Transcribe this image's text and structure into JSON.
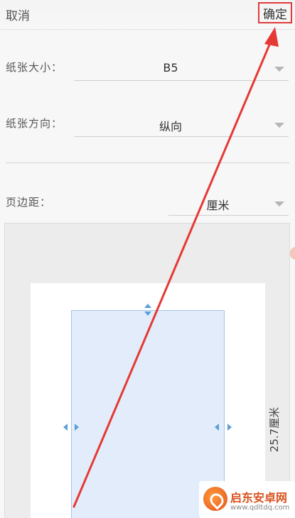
{
  "header": {
    "cancel_label": "取消",
    "confirm_label": "确定"
  },
  "paper_size": {
    "label": "纸张大小：",
    "value": "B5"
  },
  "orientation": {
    "label": "纸张方向：",
    "value": "纵向"
  },
  "margins": {
    "label": "页边距：",
    "unit_value": "厘米"
  },
  "preview": {
    "height_label": "25.7厘米"
  },
  "watermark": {
    "title": "启东安卓网",
    "url": "www.qdltdq.com"
  },
  "colors": {
    "highlight": "#e03a3a",
    "accent_arrow": "#e53935",
    "margin_handle": "#5a9fd6",
    "content_fill": "#e3ecfa"
  }
}
